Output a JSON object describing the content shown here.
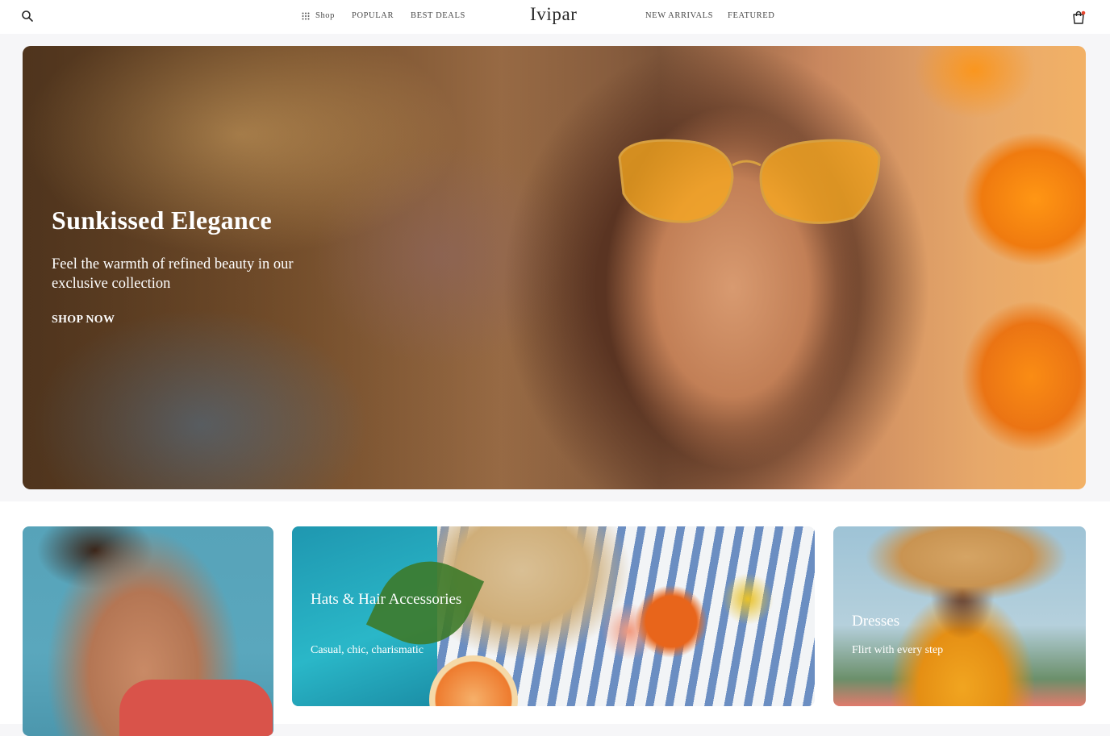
{
  "header": {
    "logo": "Ivipar",
    "nav": {
      "shop": "Shop",
      "popular": "POPULAR",
      "best_deals": "BEST DEALS",
      "new_arrivals": "NEW ARRIVALS",
      "featured": "FEATURED"
    },
    "icons": {
      "search": "search-icon",
      "grid": "grid-icon",
      "cart": "shopping-bag-icon"
    },
    "cart_badge_color": "#e8472f"
  },
  "hero": {
    "title": "Sunkissed Elegance",
    "subtitle": "Feel the warmth of refined beauty in our exclusive collection",
    "cta": "SHOP NOW"
  },
  "categories": [
    {
      "title": "",
      "subtitle": ""
    },
    {
      "title": "Hats & Hair Accessories",
      "subtitle": "Casual, chic, charismatic"
    },
    {
      "title": "Dresses",
      "subtitle": "Flirt with every step"
    }
  ]
}
